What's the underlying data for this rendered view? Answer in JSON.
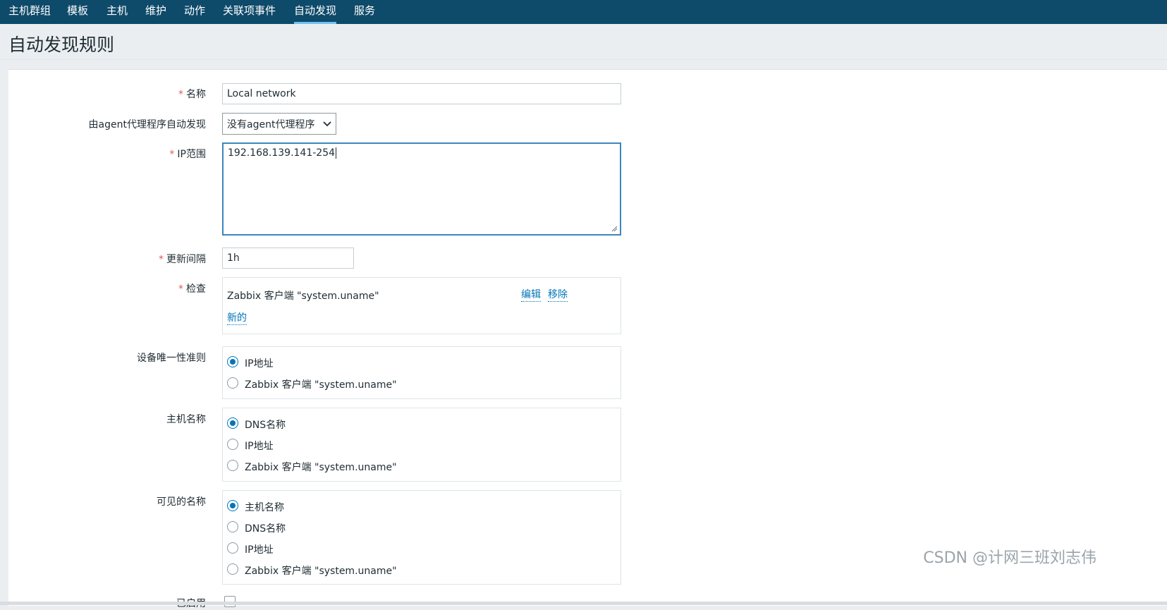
{
  "nav": {
    "items": [
      {
        "label": "主机群组"
      },
      {
        "label": "模板"
      },
      {
        "label": "主机"
      },
      {
        "label": "维护"
      },
      {
        "label": "动作"
      },
      {
        "label": "关联项事件"
      },
      {
        "label": "自动发现"
      },
      {
        "label": "服务"
      }
    ],
    "active_index": 6
  },
  "page": {
    "title": "自动发现规则"
  },
  "form": {
    "name": {
      "label": "名称",
      "value": "Local network"
    },
    "proxy": {
      "label": "由agent代理程序自动发现",
      "selected": "没有agent代理程序"
    },
    "ip_range": {
      "label": "IP范围",
      "value": "192.168.139.141-254"
    },
    "update_interval": {
      "label": "更新间隔",
      "value": "1h"
    },
    "checks": {
      "label": "检查",
      "items": [
        {
          "name": "Zabbix 客户端 \"system.uname\"",
          "edit": "编辑",
          "remove": "移除"
        }
      ],
      "new_link": "新的"
    },
    "uniqueness": {
      "label": "设备唯一性准则",
      "options": [
        "IP地址",
        "Zabbix 客户端 \"system.uname\""
      ],
      "selected": 0
    },
    "host_name": {
      "label": "主机名称",
      "options": [
        "DNS名称",
        "IP地址",
        "Zabbix 客户端 \"system.uname\""
      ],
      "selected": 0
    },
    "visible_name": {
      "label": "可见的名称",
      "options": [
        "主机名称",
        "DNS名称",
        "IP地址",
        "Zabbix 客户端 \"system.uname\""
      ],
      "selected": 0
    },
    "enabled": {
      "label": "已启用",
      "checked": false
    }
  },
  "watermark": "CSDN @计网三班刘志伟",
  "colors": {
    "nav_bg": "#0e4a6a",
    "accent": "#0275b8",
    "required": "#e45959",
    "focus_border": "#3d86bc"
  }
}
